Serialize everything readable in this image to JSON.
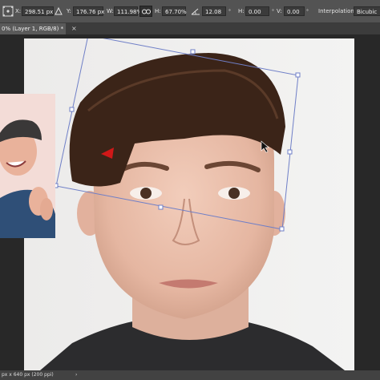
{
  "options": {
    "x_label": "X:",
    "x_value": "298.51 px",
    "y_label": "Y:",
    "y_value": "176.76 px",
    "w_label": "W:",
    "w_value": "111.98%",
    "h_label": "H:",
    "h_value": "67.70%",
    "angle_value": "12.08",
    "hskew_label": "H:",
    "hskew_value": "0.00",
    "vskew_label": "V:",
    "vskew_value": "0.00",
    "interp_label": "Interpolation:",
    "interp_value": "Bicubic"
  },
  "document": {
    "tab_label": "0% (Layer 1, RGB/8) *",
    "close_glyph": "×"
  },
  "status": {
    "info": "px x 640 px (200 ppi)"
  },
  "icons": {
    "move": "move-icon",
    "delta": "delta-icon",
    "link": "link-icon",
    "angle": "angle-icon",
    "close": "close-icon",
    "status_arrow": "chevron-right-icon"
  },
  "colors": {
    "panel": "#535353",
    "canvas_bg": "#282828",
    "transform_box": "#6f7fc7",
    "hair": "#3b2418"
  }
}
